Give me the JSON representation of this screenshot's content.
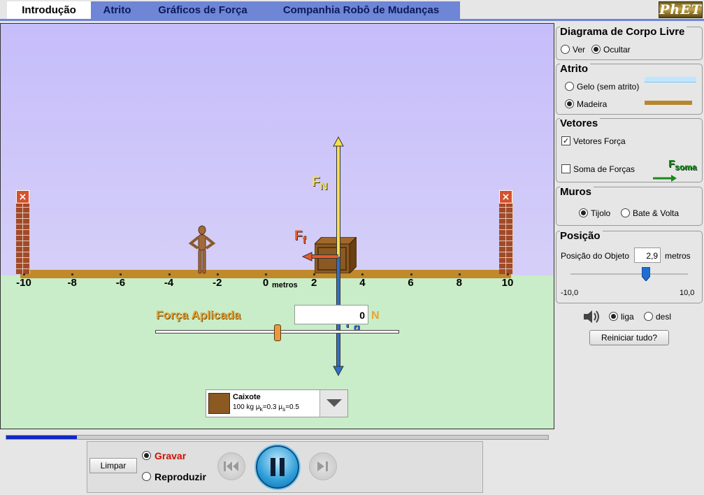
{
  "tabs": [
    {
      "label": "Introdução",
      "selected": true
    },
    {
      "label": "Atrito",
      "selected": false
    },
    {
      "label": "Gráficos de Força",
      "selected": false
    },
    {
      "label": "Companhia Robô de Mudanças",
      "selected": false
    }
  ],
  "logo": "PhET",
  "scene": {
    "axis_ticks": [
      "-10",
      "-8",
      "-6",
      "-4",
      "-2",
      "0",
      "2",
      "4",
      "6",
      "8",
      "10"
    ],
    "axis_unit": "metros",
    "force_labels": {
      "normal": "F",
      "normal_sub": "N",
      "friction": "F",
      "friction_sub": "f",
      "gravity": "F",
      "gravity_sub": "g"
    },
    "applied_force_label": "Força Aplicada",
    "applied_force_value": "0",
    "applied_force_unit": "N",
    "applied_force_fraction": 0.5
  },
  "object_selector": {
    "name": "Caixote",
    "mass": "100 kg",
    "mu_k_symbol": "μ",
    "mu_k_sub": "k",
    "mu_k_value": "=0.3",
    "mu_s_symbol": "μ",
    "mu_s_sub": "s",
    "mu_s_value": "=0.5"
  },
  "panels": {
    "free_body": {
      "title": "Diagrama de Corpo Livre",
      "options": [
        {
          "label": "Ver",
          "selected": false
        },
        {
          "label": "Ocultar",
          "selected": true
        }
      ]
    },
    "friction": {
      "title": "Atrito",
      "options": [
        {
          "label": "Gelo (sem atrito)",
          "selected": false
        },
        {
          "label": "Madeira",
          "selected": true
        }
      ]
    },
    "vectors": {
      "title": "Vetores",
      "force_vectors": {
        "label": "Vetores Força",
        "checked": true
      },
      "sum_forces": {
        "label": "Soma de Forças",
        "checked": false
      },
      "sum_icon_main": "F",
      "sum_icon_sub": "soma"
    },
    "walls": {
      "title": "Muros",
      "options": [
        {
          "label": "Tijolo",
          "selected": true
        },
        {
          "label": "Bate & Volta",
          "selected": false
        }
      ]
    },
    "position": {
      "title": "Posição",
      "label": "Posição do Objeto",
      "value": "2,9",
      "unit": "metros",
      "min_label": "-10,0",
      "max_label": "10,0",
      "value_fraction": 0.645
    }
  },
  "sound": {
    "on_label": "liga",
    "off_label": "desl",
    "on_selected": true
  },
  "reset_label": "Reiniciar tudo?",
  "playback": {
    "clear_label": "Limpar",
    "record_label": "Gravar",
    "replay_label": "Reproduzir",
    "record_selected": true,
    "progress_fraction": 0.13
  },
  "colors": {
    "normal_force": "#f5e04a",
    "friction_force": "#e85a2a",
    "gravity_force": "#2f6fc8",
    "applied_force": "#e8a330",
    "record_red": "#cc1100"
  }
}
